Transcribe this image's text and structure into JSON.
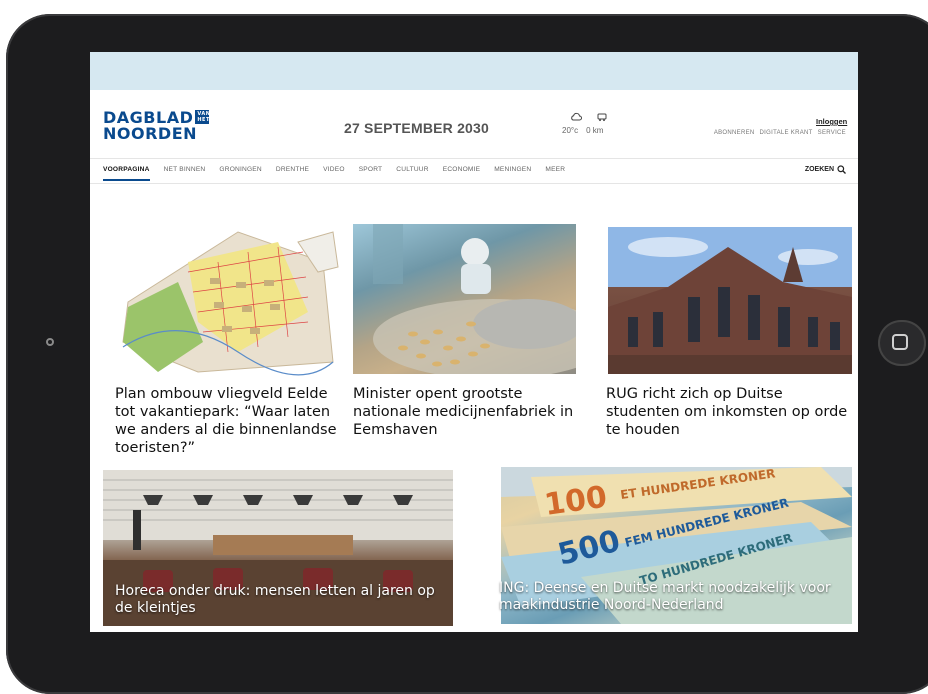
{
  "brand": {
    "line1": "DAGBLAD",
    "line2": "NOORDEN",
    "badge": "VAN HET"
  },
  "header": {
    "date": "27 SEPTEMBER 2030"
  },
  "weather": {
    "temp": "20°c",
    "rain": "0 km"
  },
  "account": {
    "login": "Inloggen",
    "links": [
      "ABONNEREN",
      "DIGITALE KRANT",
      "SERVICE"
    ]
  },
  "nav": {
    "items": [
      "VOORPAGINA",
      "NET BINNEN",
      "GRONINGEN",
      "DRENTHE",
      "VIDEO",
      "SPORT",
      "CULTUUR",
      "ECONOMIE",
      "MENINGEN",
      "MEER"
    ],
    "search": "ZOEKEN"
  },
  "articles": [
    {
      "title": "Plan ombouw vliegveld Eelde tot vakantiepark: “Waar laten we anders al die binnenlandse toeristen?”"
    },
    {
      "title": "Minister opent grootste nationale medicijnenfabriek in Eemshaven"
    },
    {
      "title": "RUG richt zich op Duitse studenten om inkomsten op orde te houden"
    },
    {
      "title": "Horeca onder druk: mensen letten al jaren op de kleintjes"
    },
    {
      "title": "ING: Deense en Duitse markt noodzakelijk voor maakindustrie Noord-Nederland"
    }
  ],
  "money_text": {
    "n100": "100",
    "n500": "500",
    "kroner1": "ET HUNDREDE KRONER",
    "kroner2": "FEM HUNDREDE KRONER",
    "kroner3": "TO HUNDREDE KRONER"
  },
  "colors": {
    "brand": "#0a4a8e",
    "ad_bar": "#d6e8f1"
  }
}
